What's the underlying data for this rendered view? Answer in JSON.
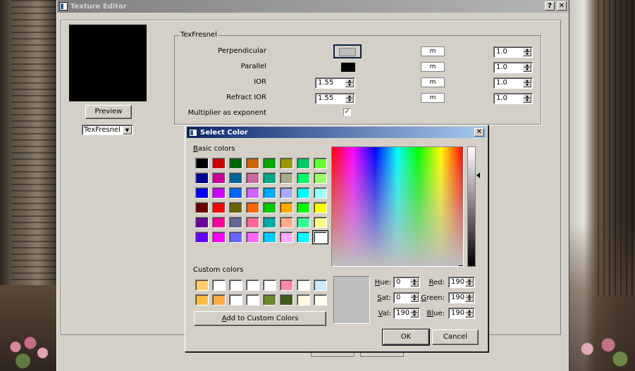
{
  "editor": {
    "title": "Texture Editor",
    "help_label": "?",
    "close_label": "✕",
    "preview_label": "Preview",
    "texture_type": "TexFresnel",
    "group_title": "TexFresnel",
    "rows": [
      {
        "label": "Perpendicular",
        "m_label": "m",
        "mult": "1.0"
      },
      {
        "label": "Parallel",
        "m_label": "m",
        "mult": "1.0"
      },
      {
        "label": "IOR",
        "value": "1.55",
        "m_label": "m",
        "mult": "1.0"
      },
      {
        "label": "Refract IOR",
        "value": "1.55",
        "m_label": "m",
        "mult": "1.0"
      }
    ],
    "multiplier_label": "Multiplier as exponent",
    "multiplier_checked": "✓",
    "swatch_colors": {
      "perpendicular": "#bdbdbd",
      "parallel": "#000000"
    }
  },
  "dialog": {
    "title": "Select Color",
    "close_label": "✕",
    "basic_label_underlined": "B",
    "basic_label_rest": "asic colors",
    "custom_label": "Custom colors",
    "basic_colors": [
      "#000000",
      "#cc0000",
      "#006600",
      "#cc6600",
      "#00aa00",
      "#999900",
      "#00cc66",
      "#66ff33",
      "#000099",
      "#cc0099",
      "#006699",
      "#cc6699",
      "#00aa88",
      "#aaaa88",
      "#00ff66",
      "#99ff66",
      "#0000ff",
      "#cc00ff",
      "#0066ff",
      "#cc66ff",
      "#00aaff",
      "#aaaaff",
      "#00ffff",
      "#99ffff",
      "#660000",
      "#ff0000",
      "#666600",
      "#ff6600",
      "#00cc00",
      "#ffaa00",
      "#00ff00",
      "#ffff00",
      "#660099",
      "#ff0099",
      "#666699",
      "#ff6699",
      "#00aaaa",
      "#ffaa88",
      "#33ff99",
      "#ffff88",
      "#6600ff",
      "#ff00ff",
      "#6666ff",
      "#ff66ff",
      "#00ccff",
      "#ffaaff",
      "#00ffff",
      "#ffffff"
    ],
    "custom_colors": [
      "#ffcc66",
      "#ffffff",
      "#ffffff",
      "#ffffff",
      "#ffffff",
      "#ff88aa",
      "#ffffff",
      "#cce8ff",
      "#ffbb44",
      "#ffaa44",
      "#ffffff",
      "#ffffff",
      "#6a8a2a",
      "#3f5a1a",
      "#fff6dd",
      "#ffffee"
    ],
    "add_label_underlined": "A",
    "add_label_rest": "dd to Custom Colors",
    "current_color": "#bebebe",
    "hue": {
      "label_u": "H",
      "label_rest": "ue:",
      "value": "0"
    },
    "sat": {
      "label_u": "S",
      "label_rest": "at:",
      "value": "0"
    },
    "val": {
      "label_u": "V",
      "label_rest": "al:",
      "value": "190"
    },
    "red": {
      "label_u": "R",
      "label_rest": "ed:",
      "value": "190"
    },
    "green": {
      "label_u": "G",
      "label_rest": "reen:",
      "value": "190"
    },
    "blue": {
      "label_u": "Bl",
      "label_rest": "ue:",
      "value": "190"
    },
    "ok_label": "OK",
    "cancel_label": "Cancel"
  }
}
